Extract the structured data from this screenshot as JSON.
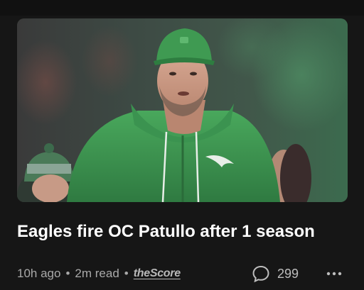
{
  "article": {
    "headline": "Eagles fire OC Patullo after 1 season",
    "time_ago": "10h ago",
    "read_time": "2m read",
    "separator": "•",
    "source": "theScore",
    "comment_count": "299",
    "more_icon": "more-horizontal-icon",
    "comment_icon": "speech-bubble-icon",
    "image_subject": "photo"
  },
  "colors": {
    "background": "#161616",
    "headline": "#ffffff",
    "meta": "#a9a9a9",
    "hoodie_green": "#3f9a52"
  }
}
